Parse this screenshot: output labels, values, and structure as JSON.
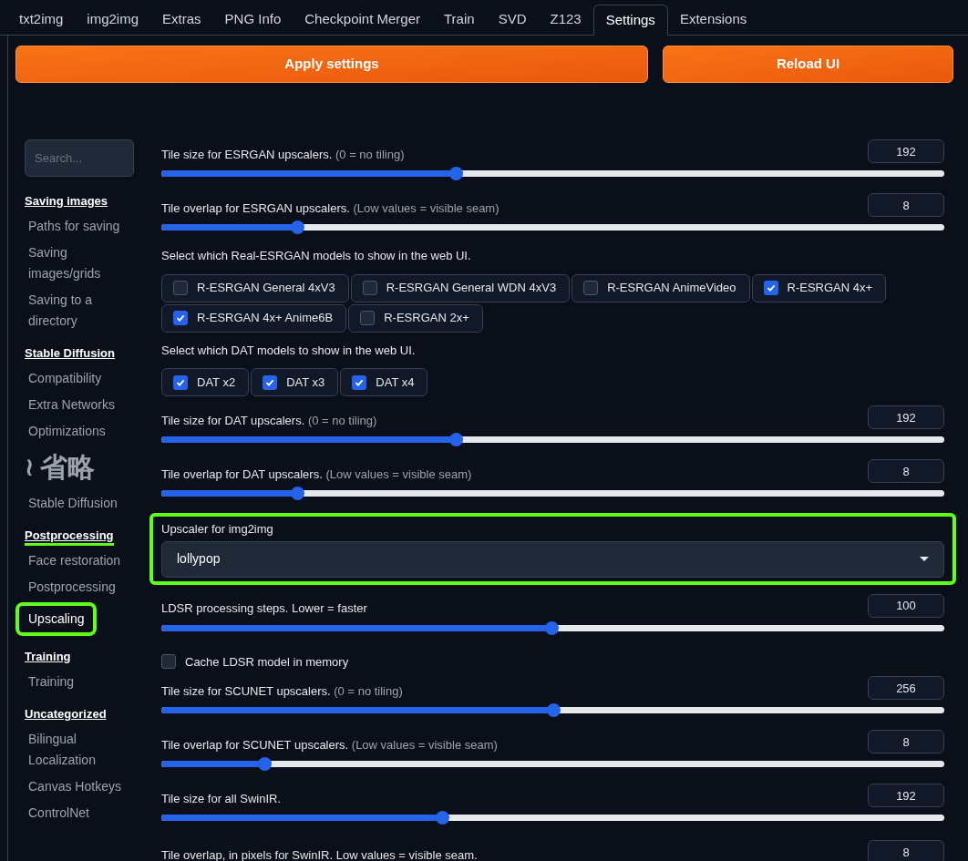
{
  "tabs": [
    {
      "label": "txt2img",
      "selected": false
    },
    {
      "label": "img2img",
      "selected": false
    },
    {
      "label": "Extras",
      "selected": false
    },
    {
      "label": "PNG Info",
      "selected": false
    },
    {
      "label": "Checkpoint Merger",
      "selected": false
    },
    {
      "label": "Train",
      "selected": false
    },
    {
      "label": "SVD",
      "selected": false
    },
    {
      "label": "Z123",
      "selected": false
    },
    {
      "label": "Settings",
      "selected": true
    },
    {
      "label": "Extensions",
      "selected": false
    }
  ],
  "buttons": [
    "Apply settings",
    "Reload UI"
  ],
  "sidebar": [
    {
      "kind": "search",
      "placeholder": "Search..."
    },
    {
      "kind": "heading",
      "label": "Saving images",
      "highlighted": false
    },
    {
      "kind": "item",
      "label": "Paths for saving",
      "selected": false,
      "highlighted": false
    },
    {
      "kind": "item",
      "label": "Saving images/grids",
      "selected": false,
      "highlighted": false
    },
    {
      "kind": "item",
      "label": "Saving to a directory",
      "selected": false,
      "highlighted": false
    },
    {
      "kind": "heading",
      "label": "Stable Diffusion",
      "highlighted": false
    },
    {
      "kind": "item",
      "label": "Compatibility",
      "selected": false,
      "highlighted": false
    },
    {
      "kind": "item",
      "label": "Extra Networks",
      "selected": false,
      "highlighted": false
    },
    {
      "kind": "item",
      "label": "Optimizations",
      "selected": false,
      "highlighted": false
    },
    {
      "kind": "note",
      "symbol": "≀",
      "label": "省略"
    },
    {
      "kind": "item",
      "label": "Stable Diffusion",
      "selected": false,
      "highlighted": false
    },
    {
      "kind": "heading",
      "label": "Postprocessing",
      "highlighted": true
    },
    {
      "kind": "item",
      "label": "Face restoration",
      "selected": false,
      "highlighted": false
    },
    {
      "kind": "item",
      "label": "Postprocessing",
      "selected": false,
      "highlighted": false
    },
    {
      "kind": "item",
      "label": "Upscaling",
      "selected": true,
      "highlighted": true
    },
    {
      "kind": "heading",
      "label": "Training",
      "highlighted": false
    },
    {
      "kind": "item",
      "label": "Training",
      "selected": false,
      "highlighted": false
    },
    {
      "kind": "heading",
      "label": "Uncategorized",
      "highlighted": false
    },
    {
      "kind": "item",
      "label": "Bilingual Localization",
      "selected": false,
      "highlighted": false
    },
    {
      "kind": "item",
      "label": "Canvas Hotkeys",
      "selected": false,
      "highlighted": false
    },
    {
      "kind": "item",
      "label": "ControlNet",
      "selected": false,
      "highlighted": false
    }
  ],
  "settings": [
    {
      "kind": "slider",
      "label": "Tile size for ESRGAN upscalers.",
      "hint": "(0 = no tiling)",
      "value": "192",
      "level": 0.376
    },
    {
      "kind": "slider",
      "label": "Tile overlap for ESRGAN upscalers.",
      "hint": "(Low values = visible seam)",
      "value": "8",
      "level": 0.173
    },
    {
      "kind": "checkgroup",
      "label": "Select which Real-ESRGAN models to show in the web UI.",
      "options": [
        {
          "label": "R-ESRGAN General 4xV3",
          "checked": false
        },
        {
          "label": "R-ESRGAN General WDN 4xV3",
          "checked": false
        },
        {
          "label": "R-ESRGAN AnimeVideo",
          "checked": false
        },
        {
          "label": "R-ESRGAN 4x+",
          "checked": true
        },
        {
          "label": "R-ESRGAN 4x+ Anime6B",
          "checked": true
        },
        {
          "label": "R-ESRGAN 2x+",
          "checked": false
        }
      ]
    },
    {
      "kind": "checkgroup",
      "label": "Select which DAT models to show in the web UI.",
      "options": [
        {
          "label": "DAT x2",
          "checked": true
        },
        {
          "label": "DAT x3",
          "checked": true
        },
        {
          "label": "DAT x4",
          "checked": true
        }
      ]
    },
    {
      "kind": "slider",
      "label": "Tile size for DAT upscalers.",
      "hint": "(0 = no tiling)",
      "value": "192",
      "level": 0.376
    },
    {
      "kind": "slider",
      "label": "Tile overlap for DAT upscalers.",
      "hint": "(Low values = visible seam)",
      "value": "8",
      "level": 0.173
    },
    {
      "kind": "dropdown",
      "label": "Upscaler for img2img",
      "value": "lollypop",
      "highlighted": true
    },
    {
      "kind": "slider",
      "label": "LDSR processing steps. Lower = faster",
      "value": "100",
      "level": 0.498
    },
    {
      "kind": "checkbox",
      "label": "Cache LDSR model in memory",
      "checked": false
    },
    {
      "kind": "slider",
      "label": "Tile size for SCUNET upscalers.",
      "hint": "(0 = no tiling)",
      "value": "256",
      "level": 0.5
    },
    {
      "kind": "slider",
      "label": "Tile overlap for SCUNET upscalers.",
      "hint": "(Low values = visible seam)",
      "value": "8",
      "level": 0.132
    },
    {
      "kind": "slider",
      "label": "Tile size for all SwinIR.",
      "value": "192",
      "level": 0.358
    },
    {
      "kind": "cut",
      "label": "Tile overlap, in pixels for SwinIR. Low values = visible seam.",
      "value": "8"
    }
  ]
}
